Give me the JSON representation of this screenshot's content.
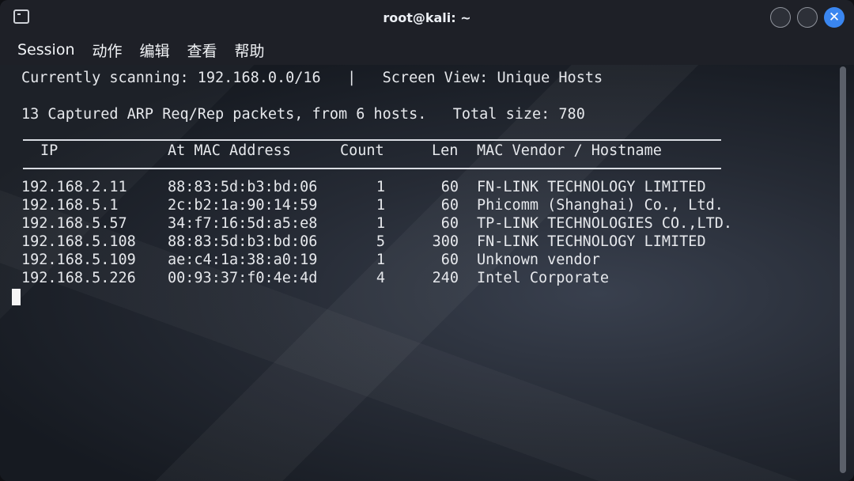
{
  "window": {
    "title": "root@kali: ~"
  },
  "menu": [
    "Session",
    "动作",
    "编辑",
    "查看",
    "帮助"
  ],
  "terminal": {
    "status_line": "Currently scanning: 192.168.0.0/16   |   Screen View: Unique Hosts",
    "summary_line": "13 Captured ARP Req/Rep packets, from 6 hosts.   Total size: 780",
    "headers": {
      "ip": "IP",
      "mac": "At MAC Address",
      "count": "Count",
      "len": "Len",
      "vendor": "MAC Vendor / Hostname"
    },
    "rows": [
      {
        "ip": "192.168.2.11",
        "mac": "88:83:5d:b3:bd:06",
        "count": "1",
        "len": "60",
        "vendor": "FN-LINK TECHNOLOGY LIMITED"
      },
      {
        "ip": "192.168.5.1",
        "mac": "2c:b2:1a:90:14:59",
        "count": "1",
        "len": "60",
        "vendor": "Phicomm (Shanghai) Co., Ltd."
      },
      {
        "ip": "192.168.5.57",
        "mac": "34:f7:16:5d:a5:e8",
        "count": "1",
        "len": "60",
        "vendor": "TP-LINK TECHNOLOGIES CO.,LTD."
      },
      {
        "ip": "192.168.5.108",
        "mac": "88:83:5d:b3:bd:06",
        "count": "5",
        "len": "300",
        "vendor": "FN-LINK TECHNOLOGY LIMITED"
      },
      {
        "ip": "192.168.5.109",
        "mac": "ae:c4:1a:38:a0:19",
        "count": "1",
        "len": "60",
        "vendor": "Unknown vendor"
      },
      {
        "ip": "192.168.5.226",
        "mac": "00:93:37:f0:4e:4d",
        "count": "4",
        "len": "240",
        "vendor": "Intel Corporate"
      }
    ]
  },
  "icons": {
    "app": "terminal-icon",
    "minimize": "minimize-icon",
    "maximize": "maximize-icon",
    "close": "close-icon"
  },
  "colors": {
    "close_button": "#3a86f0",
    "text": "#e6e8ec"
  }
}
